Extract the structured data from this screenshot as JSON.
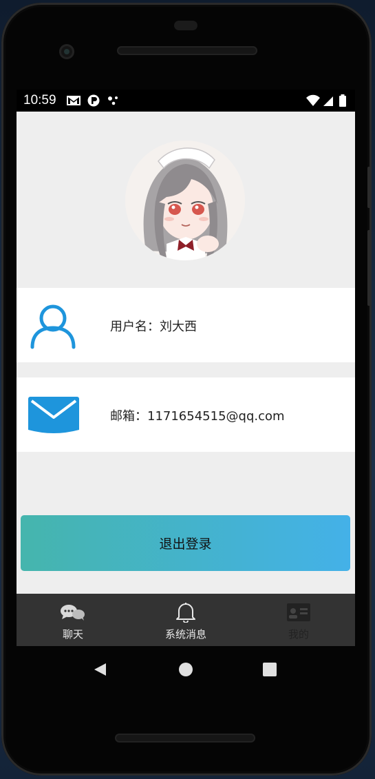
{
  "status_bar": {
    "time": "10:59",
    "left_icons": [
      "gmail-icon",
      "app-notification-icon",
      "dots-icon"
    ],
    "right_icons": [
      "wifi-icon",
      "signal-icon",
      "battery-icon"
    ]
  },
  "profile": {
    "avatar_icon": "avatar-image",
    "username_row": {
      "icon": "user-icon",
      "label": "用户名：刘大西"
    },
    "email_row": {
      "icon": "mail-icon",
      "label": "邮箱：1171654515@qq.com"
    }
  },
  "logout_button": {
    "label": "退出登录",
    "colors": [
      "#45b5ad",
      "#44b1e8"
    ]
  },
  "tabs": [
    {
      "label": "聊天",
      "icon": "chat-bubbles-icon",
      "active": true
    },
    {
      "label": "系统消息",
      "icon": "bell-icon",
      "active": true
    },
    {
      "label": "我的",
      "icon": "profile-card-icon",
      "active": false
    }
  ],
  "nav_bar": [
    "back-icon",
    "home-icon",
    "recents-icon"
  ],
  "colors": {
    "accent_blue": "#1e95dc",
    "tabbar": "#333333",
    "background": "#eeeeee"
  }
}
